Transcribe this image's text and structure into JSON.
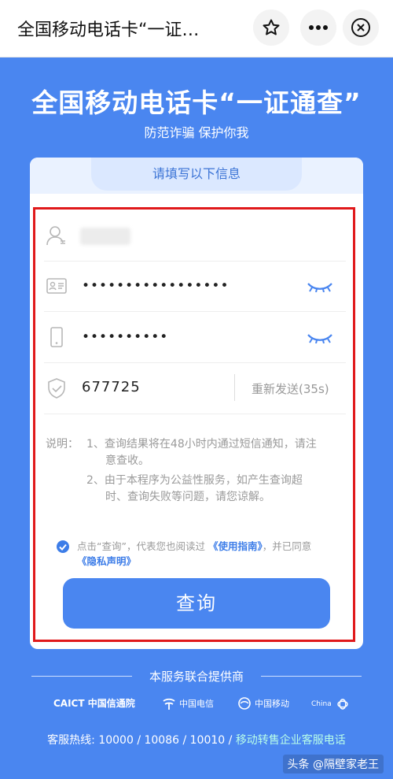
{
  "window": {
    "title": "全国移动电话卡“一证…",
    "icons": [
      "star-icon",
      "more-icon",
      "close-icon"
    ]
  },
  "hero": {
    "title": "全国移动电话卡“一证通查”",
    "subtitle": "防范诈骗 保护你我"
  },
  "form": {
    "tab_label": "请填写以下信息",
    "id_dots": "•••••••••••••••••",
    "phone_dots": "••••••••••",
    "code_value": "677725",
    "resend_label": "重新发送(35s)"
  },
  "notes": {
    "label": "说明：",
    "item1_a": "1、查询结果将在48小时内通过短信通知，请注",
    "item1_b": "意查收。",
    "item2_a": "2、由于本程序为公益性服务，如产生查询超",
    "item2_b": "时、查询失败等问题，请您谅解。"
  },
  "agreement": {
    "prefix": "点击“查询”，代表您也阅读过",
    "guide_link": "《使用指南》",
    "middle": "，并已同意",
    "privacy_link": "《隐私声明》"
  },
  "query_button": "查询",
  "footer": {
    "provided_by": "本服务联合提供商",
    "logos": [
      "CAICT 中国信通院",
      "中国电信",
      "中国移动",
      "China"
    ],
    "hotline": "客服热线: 10000 / 10086 / 10010 / ",
    "hotline_link": "移动转售企业客服电话"
  },
  "watermark": "头条 @隔壁家老王",
  "colors": {
    "brand_blue": "#4a86f0",
    "highlight_red": "#e0191b",
    "link_blue": "#3d7de8"
  }
}
